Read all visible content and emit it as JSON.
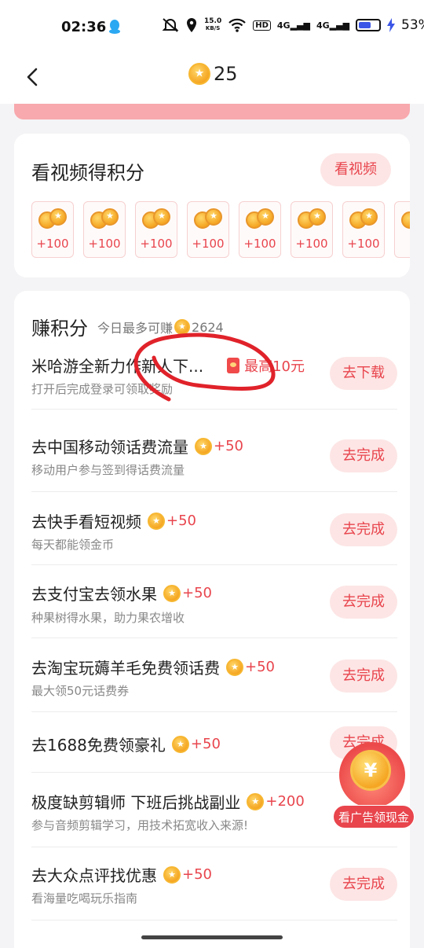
{
  "status_bar": {
    "time": "02:36",
    "net_speed_value": "15.0",
    "net_speed_unit": "KB/S",
    "hd_label": "HD",
    "signal_1": "4G",
    "signal_2": "4G",
    "battery_percent": "53%",
    "battery_level": 0.53
  },
  "header": {
    "points": "25"
  },
  "video_section": {
    "title": "看视频得积分",
    "button_label": "看视频",
    "rewards": [
      "+100",
      "+100",
      "+100",
      "+100",
      "+100",
      "+100",
      "+100",
      "+"
    ]
  },
  "earn_section": {
    "title": "赚积分",
    "subtitle_prefix": "今日最多可赚",
    "subtitle_value": "2624",
    "tasks": [
      {
        "name": "米哈游全新力作新人下...",
        "reward": "",
        "max_reward": "最高10元",
        "desc": "打开后完成登录可领取奖励",
        "button": "去下载"
      },
      {
        "name": "去中国移动领话费流量",
        "reward": "+50",
        "desc": "移动用户参与签到得话费流量",
        "button": "去完成"
      },
      {
        "name": "去快手看短视频",
        "reward": "+50",
        "desc": "每天都能领金币",
        "button": "去完成"
      },
      {
        "name": "去支付宝去领水果",
        "reward": "+50",
        "desc": "种果树得水果，助力果农增收",
        "button": "去完成"
      },
      {
        "name": "去淘宝玩薅羊毛免费领话费",
        "reward": "+50",
        "desc": "最大领50元话费券",
        "button": "去完成"
      },
      {
        "name": "去1688免费领豪礼",
        "reward": "+50",
        "desc": "",
        "button": "去完成"
      },
      {
        "name": "极度缺剪辑师 下班后挑战副业",
        "reward": "+200",
        "desc": "参与音频剪辑学习，用技术拓宽收入来源!",
        "button": ""
      },
      {
        "name": "去大众点评找优惠",
        "reward": "+50",
        "desc": "看海量吃喝玩乐指南",
        "button": "去完成"
      }
    ]
  },
  "floating_ad": {
    "label": "看广告领现金",
    "symbol": "¥"
  },
  "colors": {
    "accent": "#e8454d",
    "button_bg": "#fde5e5",
    "annotation": "#e0222a"
  }
}
